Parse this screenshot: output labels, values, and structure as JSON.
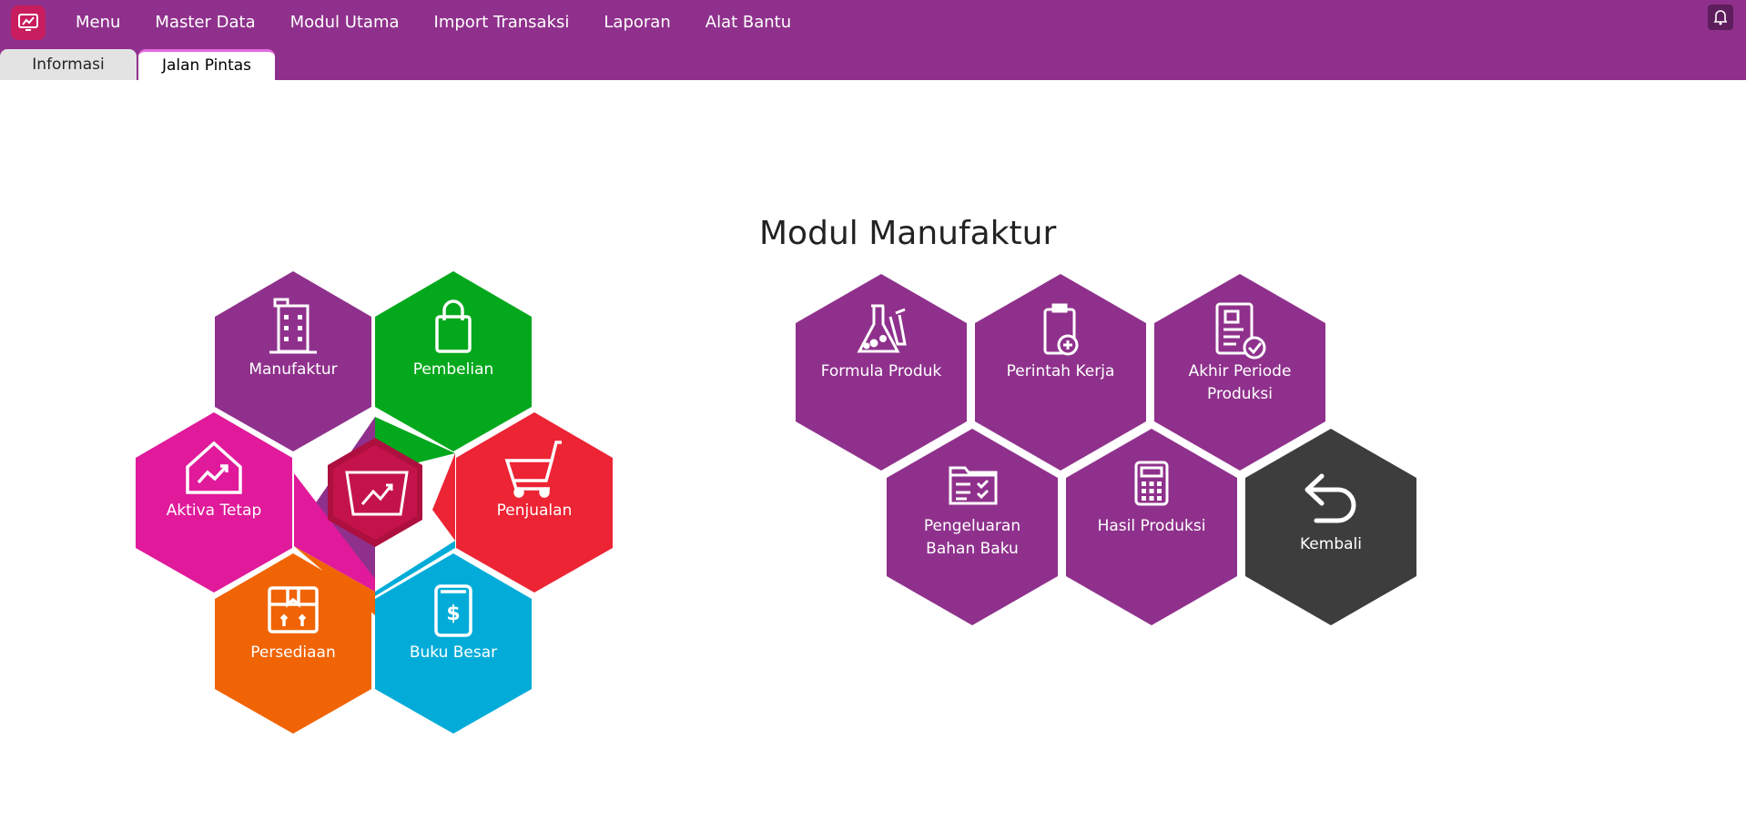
{
  "app": {
    "colors": {
      "brand": "#8f318c",
      "logo": "#c81d5e",
      "manufaktur": "#8f318c",
      "pembelian": "#04a81d",
      "penjualan": "#ec2434",
      "buku_besar": "#03acd8",
      "persediaan": "#f06405",
      "aktiva_tetap": "#e01a9a",
      "center": "#c4134a",
      "kembali": "#3d3d3d"
    },
    "icons": {
      "logo": "chart-monitor-icon",
      "bell": "bell-icon"
    }
  },
  "menu": {
    "items": [
      "Menu",
      "Master Data",
      "Modul Utama",
      "Import Transaksi",
      "Laporan",
      "Alat Bantu"
    ]
  },
  "tabs": {
    "informasi": "Informasi",
    "jalan_pintas": "Jalan Pintas",
    "active": "Jalan Pintas"
  },
  "shortcut": {
    "title": "Modul Manufaktur",
    "ring": {
      "manufaktur": {
        "label": "Manufaktur",
        "icon": "building-icon"
      },
      "pembelian": {
        "label": "Pembelian",
        "icon": "shopping-bag-icon"
      },
      "aktiva_tetap": {
        "label": "Aktiva Tetap",
        "icon": "house-chart-icon"
      },
      "penjualan": {
        "label": "Penjualan",
        "icon": "cart-icon"
      },
      "persediaan": {
        "label": "Persediaan",
        "icon": "box-icon"
      },
      "buku_besar": {
        "label": "Buku Besar",
        "icon": "ledger-icon"
      },
      "center": {
        "icon": "monitor-chart-icon"
      }
    },
    "modules": {
      "formula_produk": {
        "label": "Formula Produk",
        "icon": "flask-icon"
      },
      "perintah_kerja": {
        "label": "Perintah Kerja",
        "icon": "clipboard-plus-icon"
      },
      "akhir_periode_produksi": {
        "line1": "Akhir Periode",
        "line2": "Produksi",
        "icon": "document-check-icon"
      },
      "pengeluaran_bahan_baku": {
        "line1": "Pengeluaran",
        "line2": "Bahan Baku",
        "icon": "folder-checklist-icon"
      },
      "hasil_produksi": {
        "label": "Hasil Produksi",
        "icon": "calculator-icon"
      },
      "kembali": {
        "label": "Kembali",
        "icon": "back-arrow-icon"
      }
    }
  }
}
